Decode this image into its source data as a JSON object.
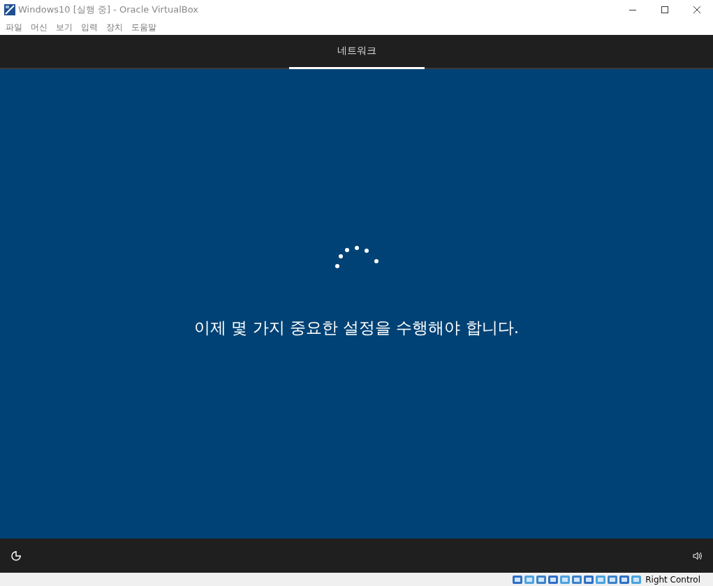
{
  "window": {
    "title": "Windows10 [실행 중] - Oracle VirtualBox"
  },
  "menu": [
    "파일",
    "머신",
    "보기",
    "입력",
    "장치",
    "도움말"
  ],
  "tabs": [
    {
      "label": "네트워크",
      "selected": true
    }
  ],
  "message": "이제 몇 가지 중요한 설정을 수행해야 합니다.",
  "status_bar": {
    "host_key": "Right Control"
  }
}
